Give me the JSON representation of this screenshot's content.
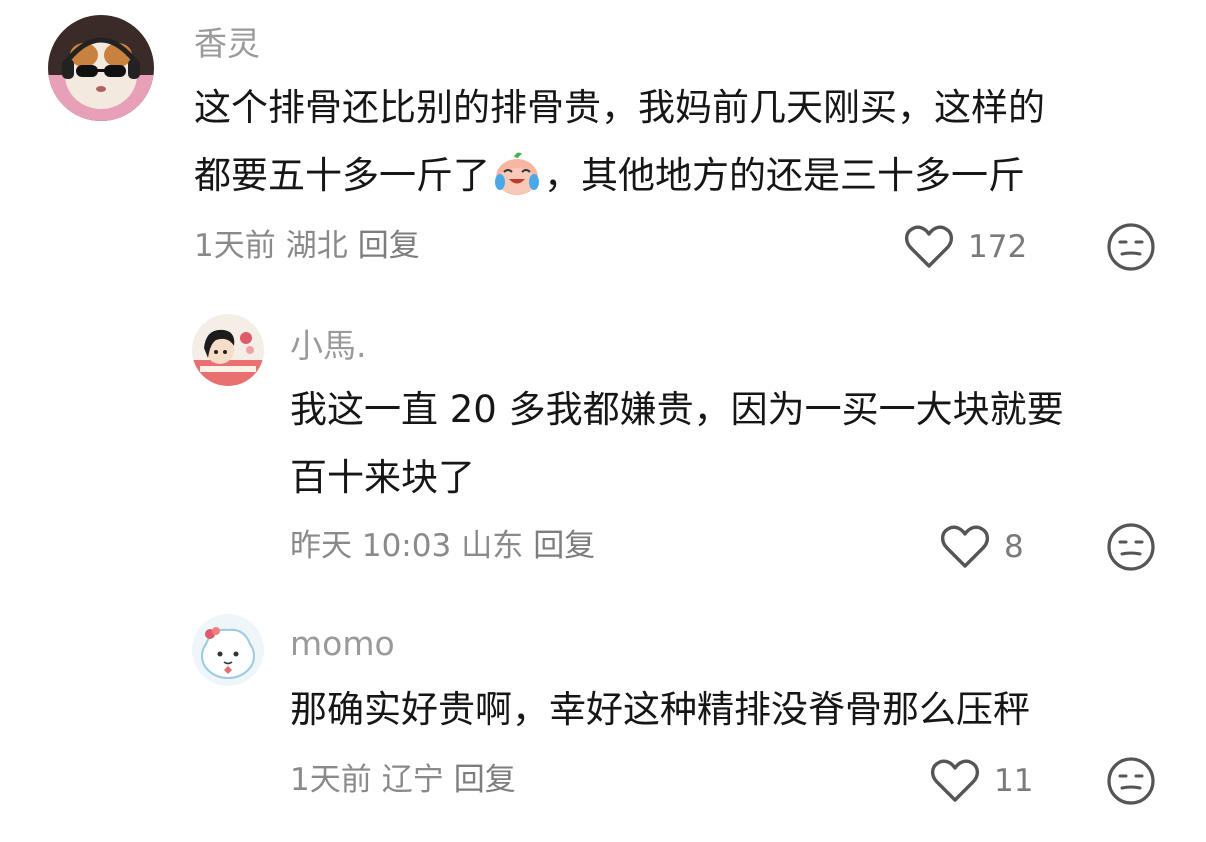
{
  "comments": [
    {
      "username": "香灵",
      "lines": [
        "这个排骨还比别的排骨贵，我妈前几天刚买，这样的",
        "都要五十多一斤了",
        "，其他地方的还是三十多一斤"
      ],
      "inline_emoji": "crying-laughing-emoji",
      "time": "1天前",
      "location": "湖北",
      "reply_label": "回复",
      "likes": "172"
    },
    {
      "username": "小馬.",
      "lines": [
        "我这一直 20 多我都嫌贵，因为一买一大块就要",
        "百十来块了"
      ],
      "time": "昨天 10:03",
      "location": "山东",
      "reply_label": "回复",
      "likes": "8"
    },
    {
      "username": "momo",
      "lines": [
        "那确实好贵啊，幸好这种精排没脊骨那么压秤"
      ],
      "time": "1天前",
      "location": "辽宁",
      "reply_label": "回复",
      "likes": "11"
    }
  ],
  "icons": {
    "like": "heart-outline-icon",
    "dislike": "meh-face-icon"
  },
  "colors": {
    "text": "#161616",
    "secondary": "#9a9a9a",
    "icon": "#555555"
  }
}
